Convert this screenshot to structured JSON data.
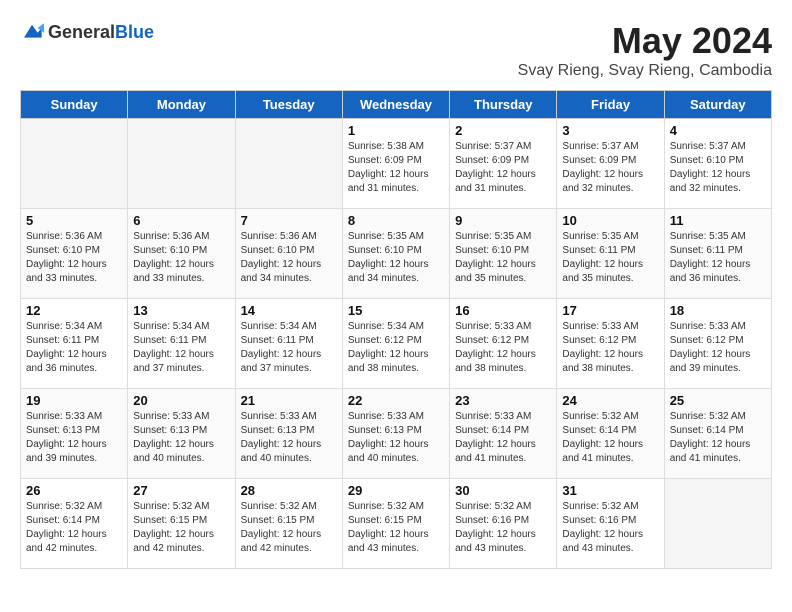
{
  "logo": {
    "general": "General",
    "blue": "Blue"
  },
  "title": "May 2024",
  "location": "Svay Rieng, Svay Rieng, Cambodia",
  "days_of_week": [
    "Sunday",
    "Monday",
    "Tuesday",
    "Wednesday",
    "Thursday",
    "Friday",
    "Saturday"
  ],
  "weeks": [
    [
      {
        "day": "",
        "empty": true
      },
      {
        "day": "",
        "empty": true
      },
      {
        "day": "",
        "empty": true
      },
      {
        "day": "1",
        "sunrise": "Sunrise: 5:38 AM",
        "sunset": "Sunset: 6:09 PM",
        "daylight": "Daylight: 12 hours and 31 minutes."
      },
      {
        "day": "2",
        "sunrise": "Sunrise: 5:37 AM",
        "sunset": "Sunset: 6:09 PM",
        "daylight": "Daylight: 12 hours and 31 minutes."
      },
      {
        "day": "3",
        "sunrise": "Sunrise: 5:37 AM",
        "sunset": "Sunset: 6:09 PM",
        "daylight": "Daylight: 12 hours and 32 minutes."
      },
      {
        "day": "4",
        "sunrise": "Sunrise: 5:37 AM",
        "sunset": "Sunset: 6:10 PM",
        "daylight": "Daylight: 12 hours and 32 minutes."
      }
    ],
    [
      {
        "day": "5",
        "sunrise": "Sunrise: 5:36 AM",
        "sunset": "Sunset: 6:10 PM",
        "daylight": "Daylight: 12 hours and 33 minutes."
      },
      {
        "day": "6",
        "sunrise": "Sunrise: 5:36 AM",
        "sunset": "Sunset: 6:10 PM",
        "daylight": "Daylight: 12 hours and 33 minutes."
      },
      {
        "day": "7",
        "sunrise": "Sunrise: 5:36 AM",
        "sunset": "Sunset: 6:10 PM",
        "daylight": "Daylight: 12 hours and 34 minutes."
      },
      {
        "day": "8",
        "sunrise": "Sunrise: 5:35 AM",
        "sunset": "Sunset: 6:10 PM",
        "daylight": "Daylight: 12 hours and 34 minutes."
      },
      {
        "day": "9",
        "sunrise": "Sunrise: 5:35 AM",
        "sunset": "Sunset: 6:10 PM",
        "daylight": "Daylight: 12 hours and 35 minutes."
      },
      {
        "day": "10",
        "sunrise": "Sunrise: 5:35 AM",
        "sunset": "Sunset: 6:11 PM",
        "daylight": "Daylight: 12 hours and 35 minutes."
      },
      {
        "day": "11",
        "sunrise": "Sunrise: 5:35 AM",
        "sunset": "Sunset: 6:11 PM",
        "daylight": "Daylight: 12 hours and 36 minutes."
      }
    ],
    [
      {
        "day": "12",
        "sunrise": "Sunrise: 5:34 AM",
        "sunset": "Sunset: 6:11 PM",
        "daylight": "Daylight: 12 hours and 36 minutes."
      },
      {
        "day": "13",
        "sunrise": "Sunrise: 5:34 AM",
        "sunset": "Sunset: 6:11 PM",
        "daylight": "Daylight: 12 hours and 37 minutes."
      },
      {
        "day": "14",
        "sunrise": "Sunrise: 5:34 AM",
        "sunset": "Sunset: 6:11 PM",
        "daylight": "Daylight: 12 hours and 37 minutes."
      },
      {
        "day": "15",
        "sunrise": "Sunrise: 5:34 AM",
        "sunset": "Sunset: 6:12 PM",
        "daylight": "Daylight: 12 hours and 38 minutes."
      },
      {
        "day": "16",
        "sunrise": "Sunrise: 5:33 AM",
        "sunset": "Sunset: 6:12 PM",
        "daylight": "Daylight: 12 hours and 38 minutes."
      },
      {
        "day": "17",
        "sunrise": "Sunrise: 5:33 AM",
        "sunset": "Sunset: 6:12 PM",
        "daylight": "Daylight: 12 hours and 38 minutes."
      },
      {
        "day": "18",
        "sunrise": "Sunrise: 5:33 AM",
        "sunset": "Sunset: 6:12 PM",
        "daylight": "Daylight: 12 hours and 39 minutes."
      }
    ],
    [
      {
        "day": "19",
        "sunrise": "Sunrise: 5:33 AM",
        "sunset": "Sunset: 6:13 PM",
        "daylight": "Daylight: 12 hours and 39 minutes."
      },
      {
        "day": "20",
        "sunrise": "Sunrise: 5:33 AM",
        "sunset": "Sunset: 6:13 PM",
        "daylight": "Daylight: 12 hours and 40 minutes."
      },
      {
        "day": "21",
        "sunrise": "Sunrise: 5:33 AM",
        "sunset": "Sunset: 6:13 PM",
        "daylight": "Daylight: 12 hours and 40 minutes."
      },
      {
        "day": "22",
        "sunrise": "Sunrise: 5:33 AM",
        "sunset": "Sunset: 6:13 PM",
        "daylight": "Daylight: 12 hours and 40 minutes."
      },
      {
        "day": "23",
        "sunrise": "Sunrise: 5:33 AM",
        "sunset": "Sunset: 6:14 PM",
        "daylight": "Daylight: 12 hours and 41 minutes."
      },
      {
        "day": "24",
        "sunrise": "Sunrise: 5:32 AM",
        "sunset": "Sunset: 6:14 PM",
        "daylight": "Daylight: 12 hours and 41 minutes."
      },
      {
        "day": "25",
        "sunrise": "Sunrise: 5:32 AM",
        "sunset": "Sunset: 6:14 PM",
        "daylight": "Daylight: 12 hours and 41 minutes."
      }
    ],
    [
      {
        "day": "26",
        "sunrise": "Sunrise: 5:32 AM",
        "sunset": "Sunset: 6:14 PM",
        "daylight": "Daylight: 12 hours and 42 minutes."
      },
      {
        "day": "27",
        "sunrise": "Sunrise: 5:32 AM",
        "sunset": "Sunset: 6:15 PM",
        "daylight": "Daylight: 12 hours and 42 minutes."
      },
      {
        "day": "28",
        "sunrise": "Sunrise: 5:32 AM",
        "sunset": "Sunset: 6:15 PM",
        "daylight": "Daylight: 12 hours and 42 minutes."
      },
      {
        "day": "29",
        "sunrise": "Sunrise: 5:32 AM",
        "sunset": "Sunset: 6:15 PM",
        "daylight": "Daylight: 12 hours and 43 minutes."
      },
      {
        "day": "30",
        "sunrise": "Sunrise: 5:32 AM",
        "sunset": "Sunset: 6:16 PM",
        "daylight": "Daylight: 12 hours and 43 minutes."
      },
      {
        "day": "31",
        "sunrise": "Sunrise: 5:32 AM",
        "sunset": "Sunset: 6:16 PM",
        "daylight": "Daylight: 12 hours and 43 minutes."
      },
      {
        "day": "",
        "empty": true
      }
    ]
  ]
}
